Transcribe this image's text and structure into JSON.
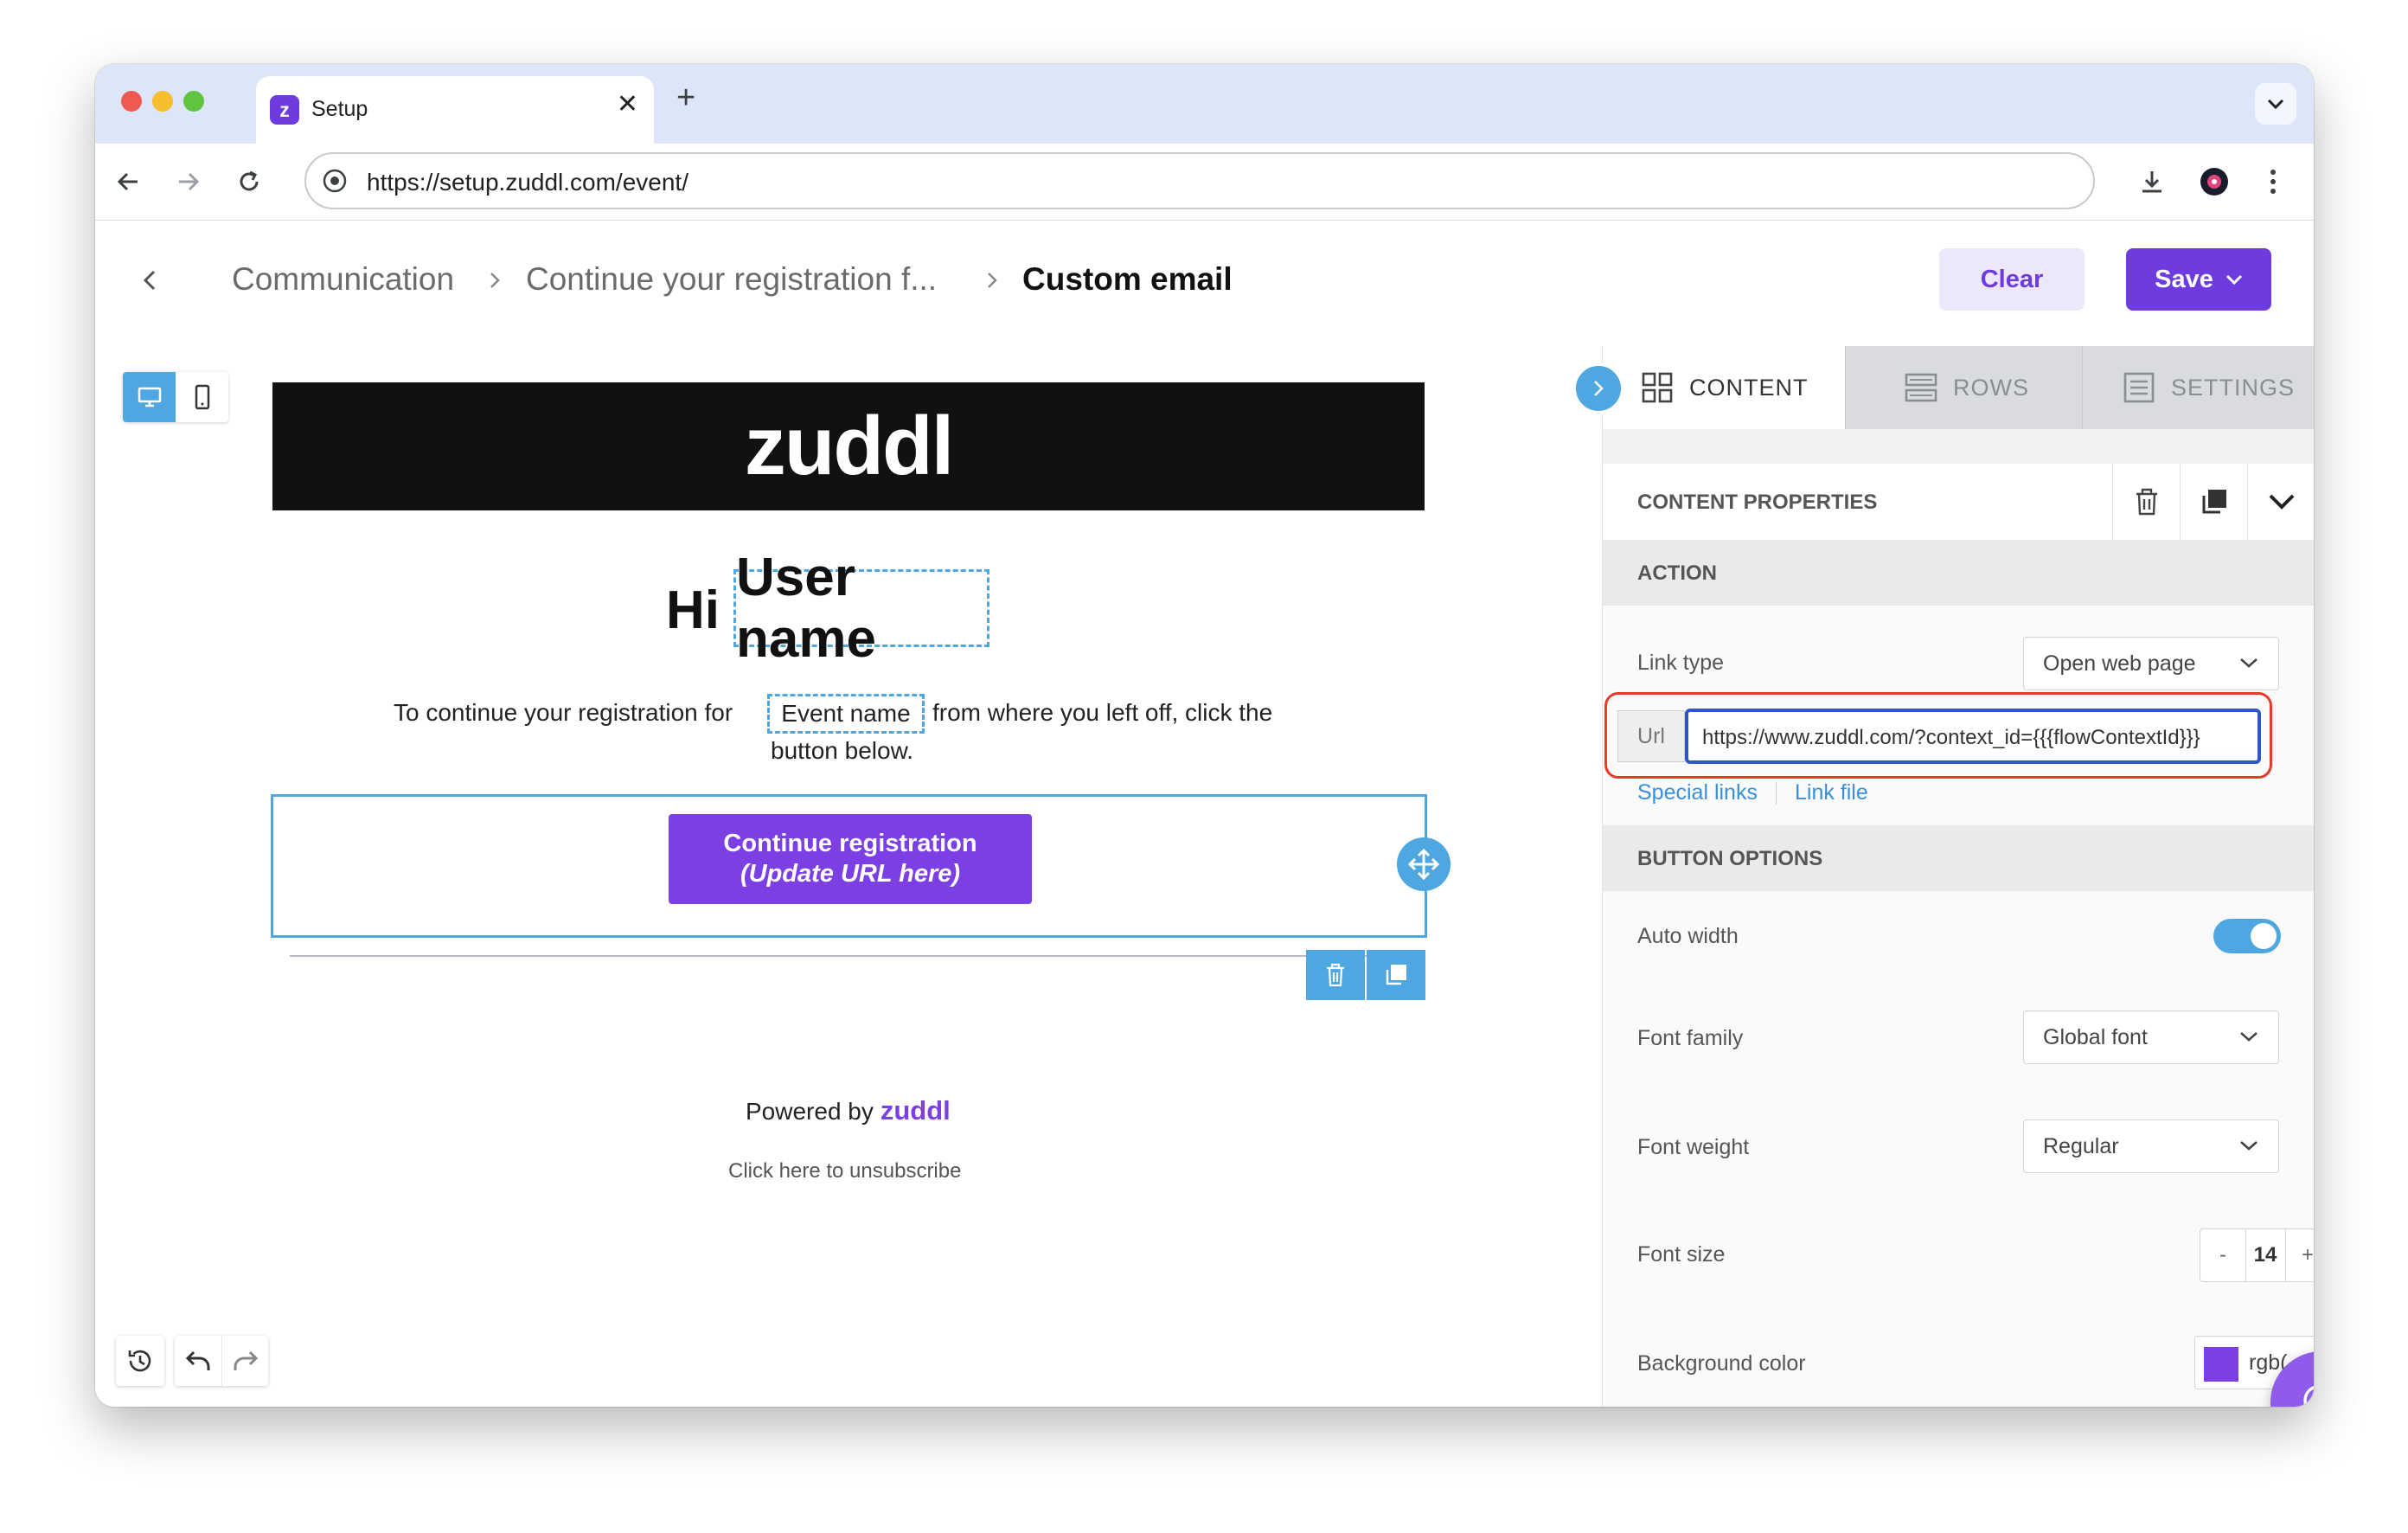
{
  "browser": {
    "tab_title": "Setup",
    "tab_favicon_letter": "z",
    "url": "https://setup.zuddl.com/event/"
  },
  "header": {
    "breadcrumbs": [
      "Communication",
      "Continue your registration f...",
      "Custom email"
    ],
    "clear_label": "Clear",
    "save_label": "Save"
  },
  "email": {
    "logo_text": "zuddl",
    "greeting_prefix": "Hi",
    "user_name_tag": "User name",
    "body_before": "To continue your registration for",
    "event_name_tag": "Event name",
    "body_after": "from where you left off, click the",
    "body_line2": "button below.",
    "button_line1": "Continue registration",
    "button_line2": "(Update URL here)",
    "powered_by": "Powered by",
    "powered_logo": "zuddl",
    "unsubscribe": "Click here to unsubscribe"
  },
  "panel": {
    "tabs": [
      "CONTENT",
      "ROWS",
      "SETTINGS"
    ],
    "active_tab": "CONTENT",
    "content_properties_title": "CONTENT PROPERTIES",
    "action": {
      "title": "ACTION",
      "link_type_label": "Link type",
      "link_type_value": "Open web page",
      "url_prefix": "Url",
      "url_value": "https://www.zuddl.com/?context_id={{{flowContextId}}}",
      "special_links": "Special links",
      "link_file": "Link file"
    },
    "button_options": {
      "title": "BUTTON OPTIONS",
      "auto_width_label": "Auto width",
      "auto_width_on": true,
      "font_family_label": "Font family",
      "font_family_value": "Global font",
      "font_weight_label": "Font weight",
      "font_weight_value": "Regular",
      "font_size_label": "Font size",
      "font_size_value": "14",
      "minus": "-",
      "plus": "+",
      "background_color_label": "Background color",
      "background_color_text": "rgb("
    }
  },
  "colors": {
    "accent": "#6d3bde",
    "email_button": "#7b3fe4",
    "selection_blue": "#4ea7e0",
    "highlight_red": "#e53b2a"
  }
}
